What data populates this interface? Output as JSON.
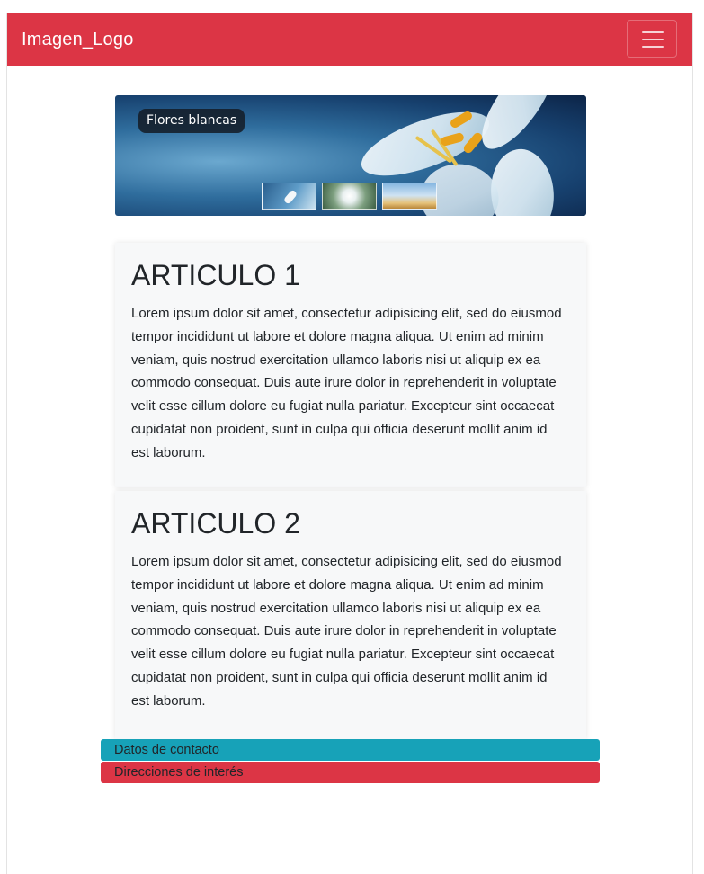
{
  "navbar": {
    "brand": "Imagen_Logo",
    "toggler_icon": "hamburger-menu-icon",
    "color": "#dc3545"
  },
  "carousel": {
    "caption": "Flores blancas",
    "thumbnails": [
      {
        "icon": "white-lily-thumbnail"
      },
      {
        "icon": "daisy-thumbnail"
      },
      {
        "icon": "landscape-thumbnail"
      }
    ]
  },
  "articles": [
    {
      "title": "ARTICULO 1",
      "body": "Lorem ipsum dolor sit amet, consectetur adipisicing elit, sed do eiusmod tempor incididunt ut labore et dolore magna aliqua. Ut enim ad minim veniam, quis nostrud exercitation ullamco laboris nisi ut aliquip ex ea commodo consequat. Duis aute irure dolor in reprehenderit in voluptate velit esse cillum dolore eu fugiat nulla pariatur. Excepteur sint occaecat cupidatat non proident, sunt in culpa qui officia deserunt mollit anim id est laborum."
    },
    {
      "title": "ARTICULO 2",
      "body": "Lorem ipsum dolor sit amet, consectetur adipisicing elit, sed do eiusmod tempor incididunt ut labore et dolore magna aliqua. Ut enim ad minim veniam, quis nostrud exercitation ullamco laboris nisi ut aliquip ex ea commodo consequat. Duis aute irure dolor in reprehenderit in voluptate velit esse cillum dolore eu fugiat nulla pariatur. Excepteur sint occaecat cupidatat non proident, sunt in culpa qui officia deserunt mollit anim id est laborum."
    }
  ],
  "footer_buttons": {
    "contact": {
      "label": "Datos de contacto",
      "color": "#17a2b8"
    },
    "interest": {
      "label": "Direcciones de interés",
      "color": "#dc3545"
    }
  }
}
